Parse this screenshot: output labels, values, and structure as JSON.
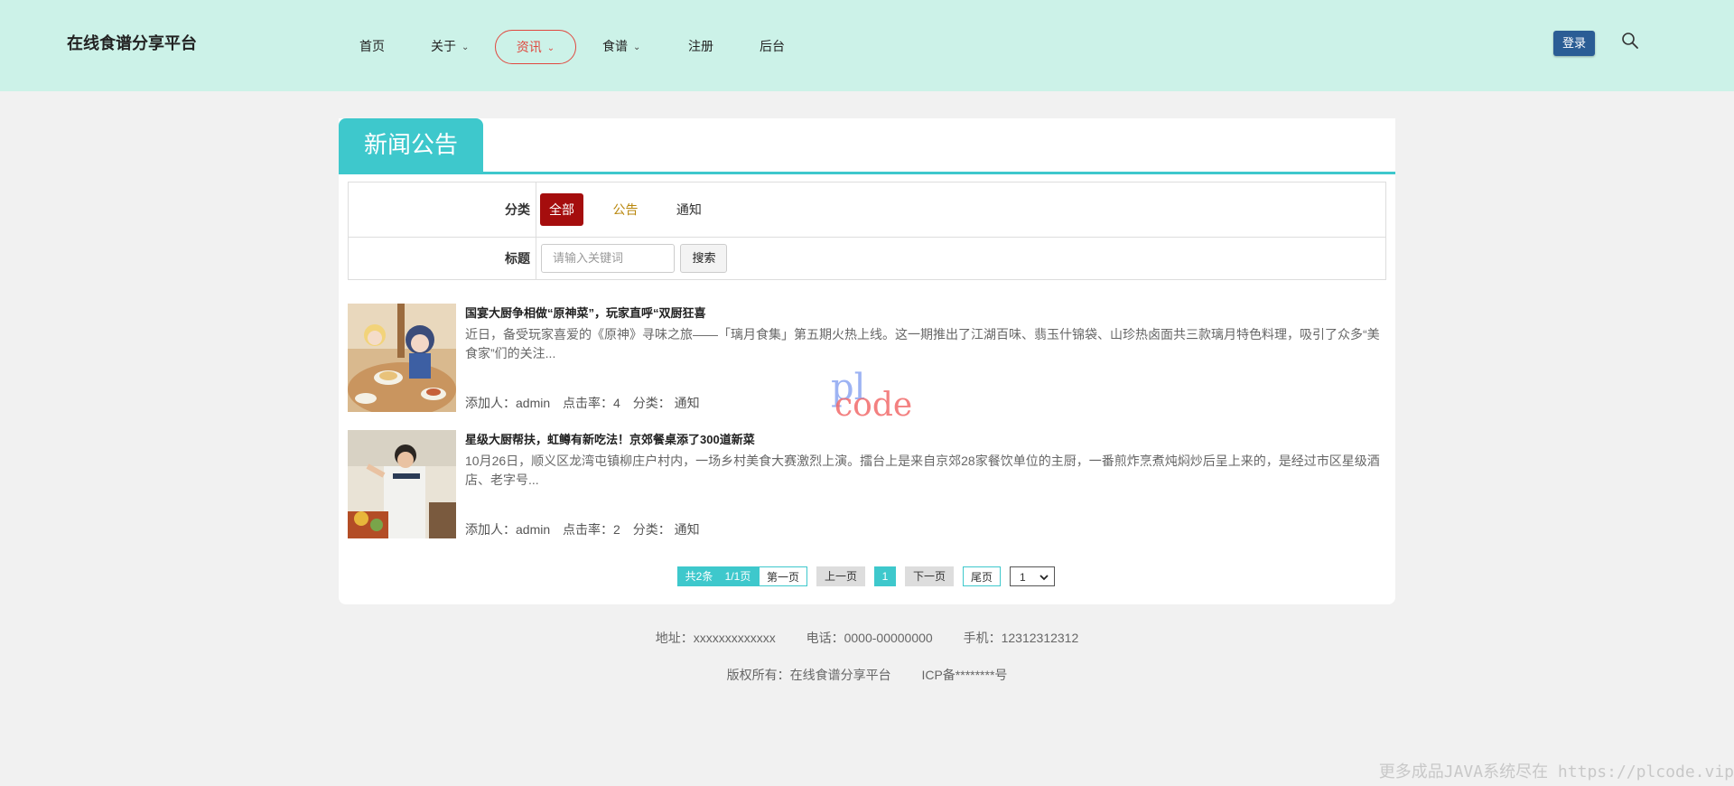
{
  "header": {
    "brand": "在线食谱分享平台",
    "nav": [
      {
        "label": "首页",
        "dropdown": false,
        "active": false
      },
      {
        "label": "关于",
        "dropdown": true,
        "active": false
      },
      {
        "label": "资讯",
        "dropdown": true,
        "active": true
      },
      {
        "label": "食谱",
        "dropdown": true,
        "active": false
      },
      {
        "label": "注册",
        "dropdown": false,
        "active": false
      },
      {
        "label": "后台",
        "dropdown": false,
        "active": false
      }
    ],
    "login_label": "登录",
    "search_icon": "search-icon"
  },
  "section": {
    "title": "新闻公告",
    "filter": {
      "category_label": "分类",
      "categories": [
        "全部",
        "公告",
        "通知"
      ],
      "selected_category": "全部",
      "title_label": "标题",
      "search_placeholder": "请输入关键词",
      "search_button": "搜索"
    },
    "news": [
      {
        "title": "国宴大厨争相做“原神菜”，玩家直呼“双厨狂喜",
        "summary": "近日，备受玩家喜爱的《原神》寻味之旅——「璃月食集」第五期火热上线。这一期推出了江湖百味、翡玉什锦袋、山珍热卤面共三款璃月特色料理，吸引了众多“美食家”们的关注...",
        "author_label": "添加人：admin",
        "clicks_label": "点击率：4",
        "category_label": "分类：  通知"
      },
      {
        "title": "星级大厨帮扶，虹鳟有新吃法！京郊餐桌添了300道新菜",
        "summary": "10月26日，顺义区龙湾屯镇柳庄户村内，一场乡村美食大赛激烈上演。擂台上是来自京郊28家餐饮单位的主厨，一番煎炸烹煮炖焖炒后呈上来的，是经过市区星级酒店、老字号...",
        "author_label": "添加人：admin",
        "clicks_label": "点击率：2",
        "category_label": "分类：  通知"
      }
    ],
    "pagination": {
      "total": "共2条",
      "pages": "1/1页",
      "first": "第一页",
      "prev": "上一页",
      "current": "1",
      "next": "下一页",
      "last": "尾页",
      "page_select": "1"
    }
  },
  "watermark": {
    "line1": "pl",
    "line2": "code"
  },
  "footer": {
    "address": "地址：xxxxxxxxxxxxx",
    "phone": "电话：0000-00000000",
    "mobile": "手机：12312312312",
    "copyright": "版权所有：在线食谱分享平台",
    "icp": "ICP备********号"
  },
  "corner_text": "更多成品JAVA系统尽在 https://plcode.vip",
  "colors": {
    "header_bg": "#ccf2e8",
    "accent": "#3ec8cc",
    "active_nav": "#e0483f",
    "selected_category": "#a50d0d",
    "login_button": "#2b5d95"
  }
}
